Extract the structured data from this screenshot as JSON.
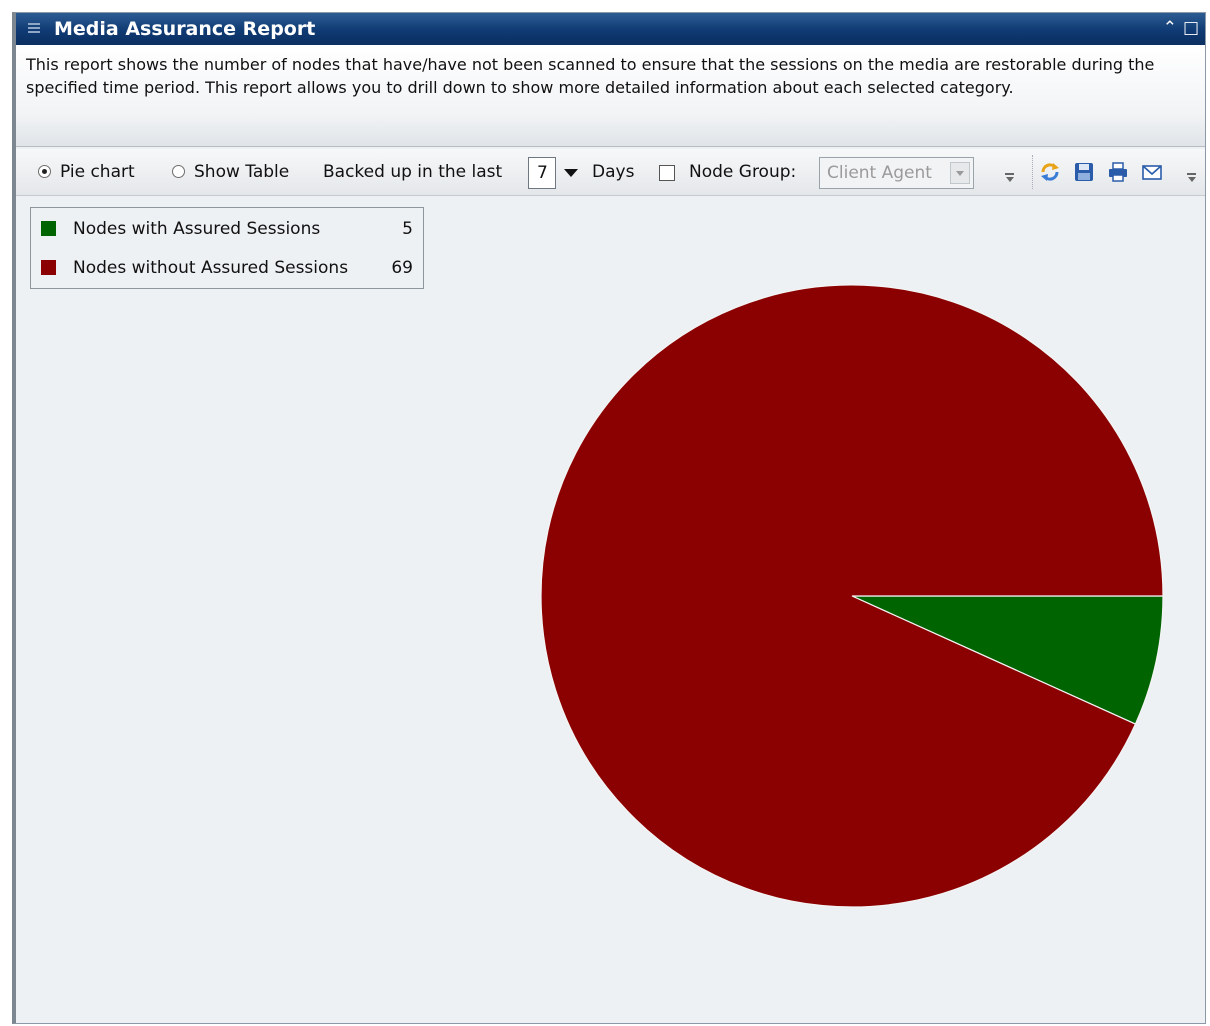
{
  "window": {
    "title": "Media Assurance Report",
    "description": "This report shows the number of nodes that have/have not been scanned to ensure that the sessions on the media are restorable during the specified time period. This report allows you to drill down to show more detailed information about each selected category."
  },
  "toolbar": {
    "pie_chart_label": "Pie chart",
    "pie_chart_selected": true,
    "show_table_label": "Show Table",
    "show_table_selected": false,
    "backed_up_label": "Backed up in the last",
    "days_value": "7",
    "days_label": "Days",
    "node_group_checked": false,
    "node_group_label": "Node Group:",
    "node_group_value": "Client Agent",
    "icons": [
      "refresh-icon",
      "save-icon",
      "print-icon",
      "email-icon"
    ]
  },
  "chart_data": {
    "type": "pie",
    "slices": [
      {
        "label": "Nodes with Assured Sessions",
        "value": 5,
        "color": "#006400"
      },
      {
        "label": "Nodes without Assured Sessions",
        "value": 69,
        "color": "#8b0000"
      }
    ]
  }
}
